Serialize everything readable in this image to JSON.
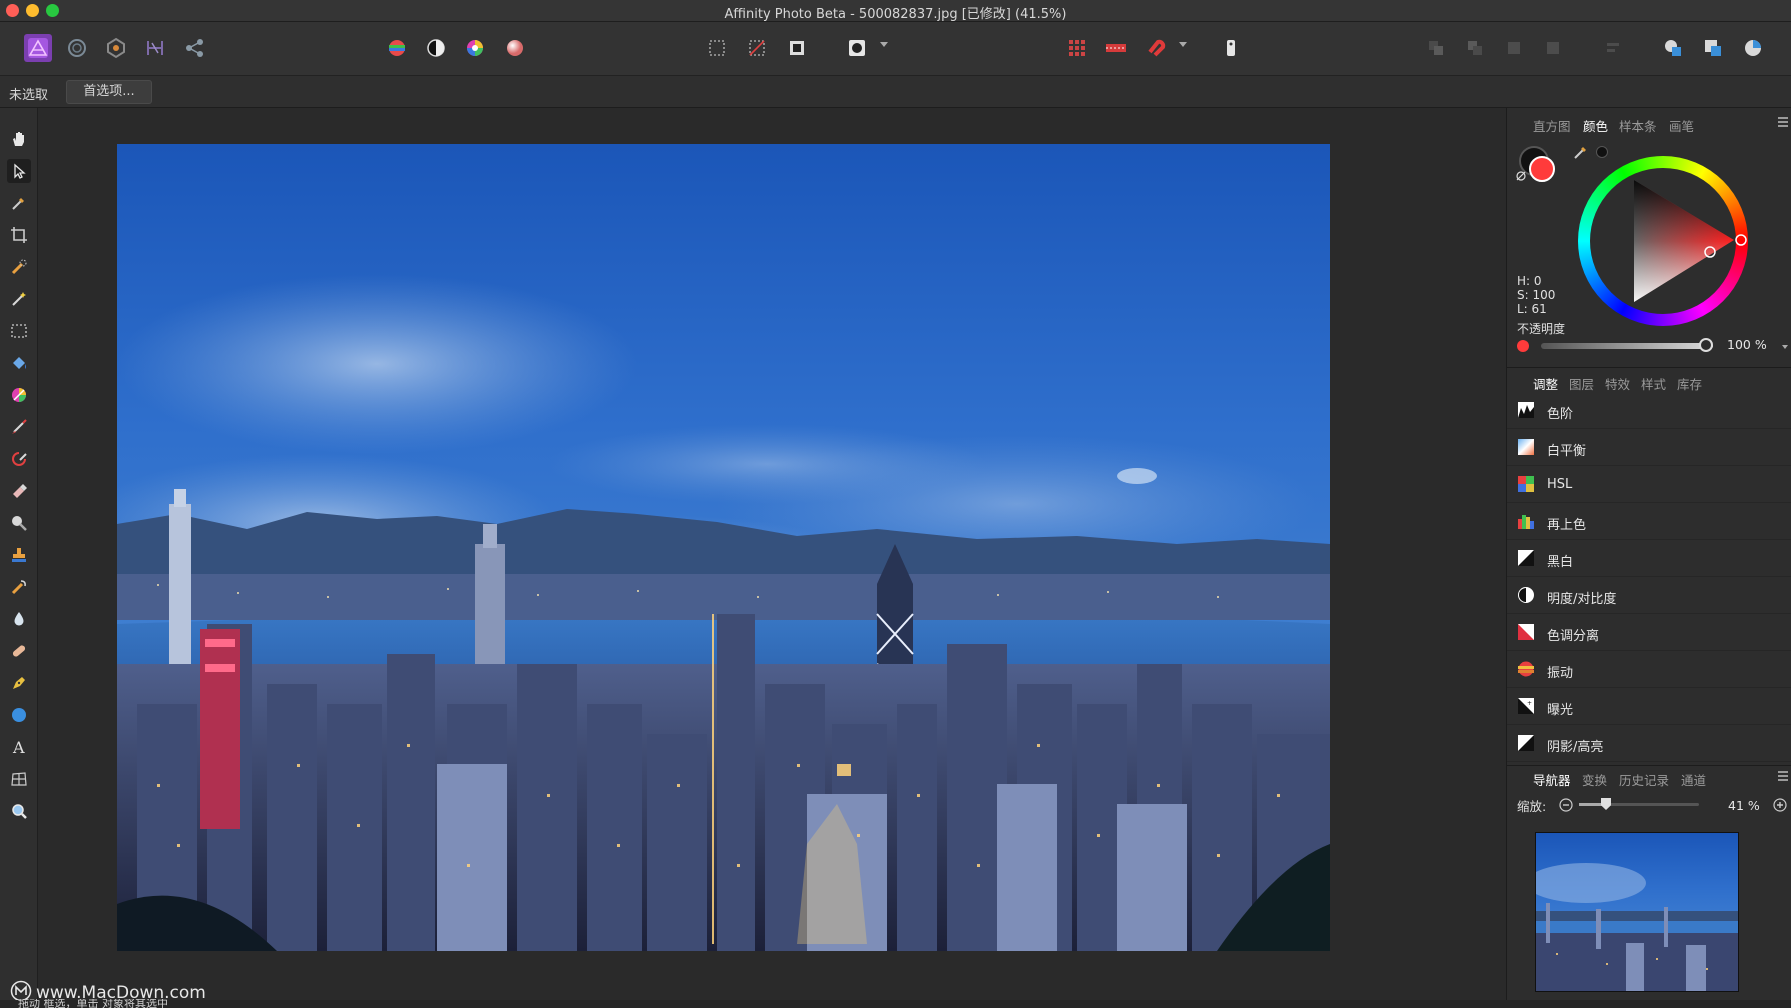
{
  "window": {
    "title": "Affinity Photo Beta - 500082837.jpg [已修改] (41.5%)"
  },
  "context_toolbar": {
    "selection_label": "未选取",
    "preferences_button": "首选项..."
  },
  "color_panel": {
    "tabs": [
      "直方图",
      "颜色",
      "样本条",
      "画笔"
    ],
    "active_tab": "颜色",
    "hsl": {
      "h": "H: 0",
      "s": "S: 100",
      "l": "L: 61"
    },
    "opacity_label": "不透明度",
    "opacity_value": "100 %",
    "opacity_fraction": 1.0,
    "fill_color": "#ff3b3b",
    "stroke_color": "#111111"
  },
  "adjustments_panel": {
    "tabs": [
      "调整",
      "图层",
      "特效",
      "样式",
      "库存"
    ],
    "active_tab": "调整",
    "items": [
      {
        "label": "色阶",
        "icon": "levels-icon"
      },
      {
        "label": "白平衡",
        "icon": "white-balance-icon"
      },
      {
        "label": "HSL",
        "icon": "hsl-icon"
      },
      {
        "label": "再上色",
        "icon": "recolor-icon"
      },
      {
        "label": "黑白",
        "icon": "black-white-icon"
      },
      {
        "label": "明度/对比度",
        "icon": "brightness-contrast-icon"
      },
      {
        "label": "色调分离",
        "icon": "posterize-icon"
      },
      {
        "label": "振动",
        "icon": "vibrance-icon"
      },
      {
        "label": "曝光",
        "icon": "exposure-icon"
      },
      {
        "label": "阴影/高亮",
        "icon": "shadows-highlights-icon"
      }
    ]
  },
  "navigator_panel": {
    "tabs": [
      "导航器",
      "变换",
      "历史记录",
      "通道"
    ],
    "active_tab": "导航器",
    "zoom_label": "缩放:",
    "zoom_value": "41 %",
    "zoom_fraction": 0.2
  },
  "watermark": {
    "text": "www.MacDown.com"
  },
  "status_bar": {
    "text": "拖动 框选，单击 对象将其选中"
  }
}
